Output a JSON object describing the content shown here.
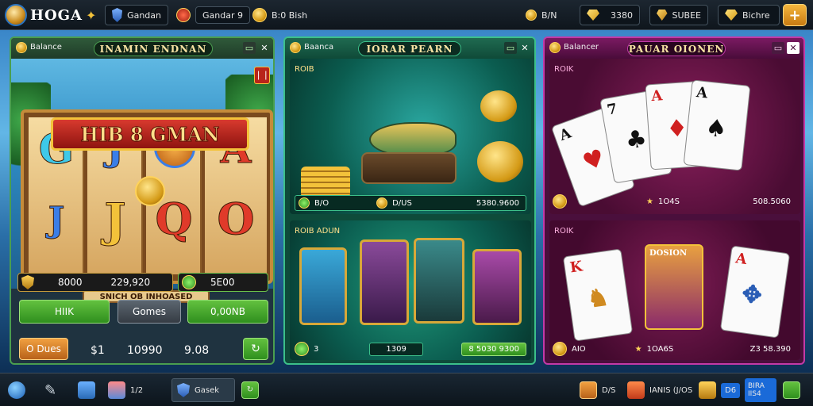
{
  "topbar": {
    "logo_text": "HOGA",
    "items": [
      {
        "label": "Gandan"
      },
      {
        "label": "Gandar 9"
      },
      {
        "label": "B:0 Bish"
      },
      {
        "label": "B/N"
      },
      {
        "value": "3380"
      },
      {
        "label": "SUBEE"
      },
      {
        "label": "Bichre"
      }
    ],
    "plus": "+"
  },
  "slot": {
    "header_label": "Balance",
    "title": "INAMIN ENDNAN",
    "banner": "HIB 8 GMAN",
    "plaque": "SNICH OB INHOASED",
    "bar_left_value": "8000",
    "bar_left_value2": "229,920",
    "bar_right_value": "5E00",
    "btn_hik": "HIIK",
    "btn_gomes": "Gomes",
    "btn_zero": "0,00NB",
    "bottom_btn": "O Dues",
    "stat1": "$1",
    "stat2": "10990",
    "stat3": "9.08",
    "close": "✕"
  },
  "fish": {
    "header_label": "Baanca",
    "title": "IORAR PEARN",
    "top_label": "ROIB",
    "top_left": "B/O",
    "top_mid": "D/US",
    "top_right": "5380.9600",
    "bot_label": "ROIB ADUN",
    "bot_left": "3",
    "bot_mid": "1309",
    "bot_right": "8 5030 9300",
    "close": "✕"
  },
  "poker": {
    "header_label": "Balancer",
    "title": "PAUAR OIONEN",
    "top_label": "ROIK",
    "top_mid": "1O4S",
    "top_right": "508.5060",
    "bot_label": "ROIK",
    "bot_left": "AIO",
    "bot_mid": "1OA6S",
    "bot_right": "Z3 58.390",
    "cards_top": [
      "A",
      "7",
      "A",
      "A"
    ],
    "cards_bot": [
      "K",
      "DOSION",
      "A"
    ]
  },
  "taskbar": {
    "items": [
      "1/2",
      "Gasek",
      "D/S",
      "IANIS (J/OS",
      "D6",
      "BIRA IIS4"
    ]
  },
  "colors": {
    "accent_green": "#3cc08a",
    "accent_magenta": "#c23aa8",
    "gold": "#f3c23a"
  }
}
